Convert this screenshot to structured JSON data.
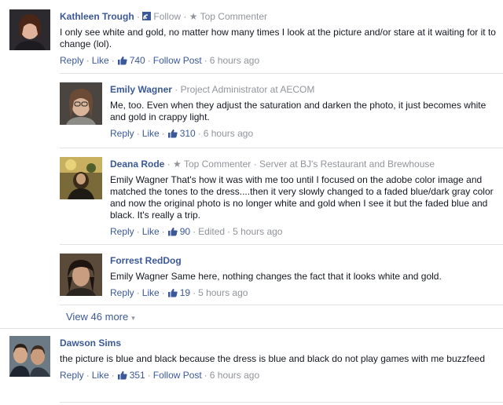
{
  "comments": [
    {
      "author": "Kathleen Trough",
      "follow": "Follow",
      "badge": "Top Commenter",
      "text": "I only see white and gold, no matter how many times I look at the picture and/or stare at it waiting for it to change (lol).",
      "reply": "Reply",
      "like": "Like",
      "likes": "740",
      "follow_post": "Follow Post",
      "time": "6 hours ago"
    },
    {
      "author": "Emily Wagner",
      "subtitle": "Project Administrator at AECOM",
      "text": "Me, too. Even when they adjust the saturation and darken the photo, it just becomes white and gold in crappy light.",
      "reply": "Reply",
      "like": "Like",
      "likes": "310",
      "time": "6 hours ago"
    },
    {
      "author": "Deana Rode",
      "badge": "Top Commenter",
      "subtitle": "Server at BJ's Restaurant and Brewhouse",
      "text": "Emily Wagner That's how it was with me too until I focused on the adobe color image and matched the tones to the dress....then it very slowly changed to a faded blue/dark gray color and now the original photo is no longer white and gold when I see it but the faded blue and black. It's really a trip.",
      "reply": "Reply",
      "like": "Like",
      "likes": "90",
      "edited": "Edited",
      "time": "5 hours ago"
    },
    {
      "author": "Forrest RedDog",
      "text": "Emily Wagner Same here, nothing changes the fact that it looks white and gold.",
      "reply": "Reply",
      "like": "Like",
      "likes": "19",
      "time": "5 hours ago"
    },
    {
      "author": "Dawson Sims",
      "text": "the picture is blue and black because the dress is blue and black do not play games with me buzzfeed",
      "reply": "Reply",
      "like": "Like",
      "likes": "351",
      "follow_post": "Follow Post",
      "time": "6 hours ago"
    }
  ],
  "view_more": "View 46 more",
  "colors": {
    "link": "#3b5998",
    "meta": "#90949c",
    "text": "#141823",
    "separator": "#e1e2e3"
  }
}
